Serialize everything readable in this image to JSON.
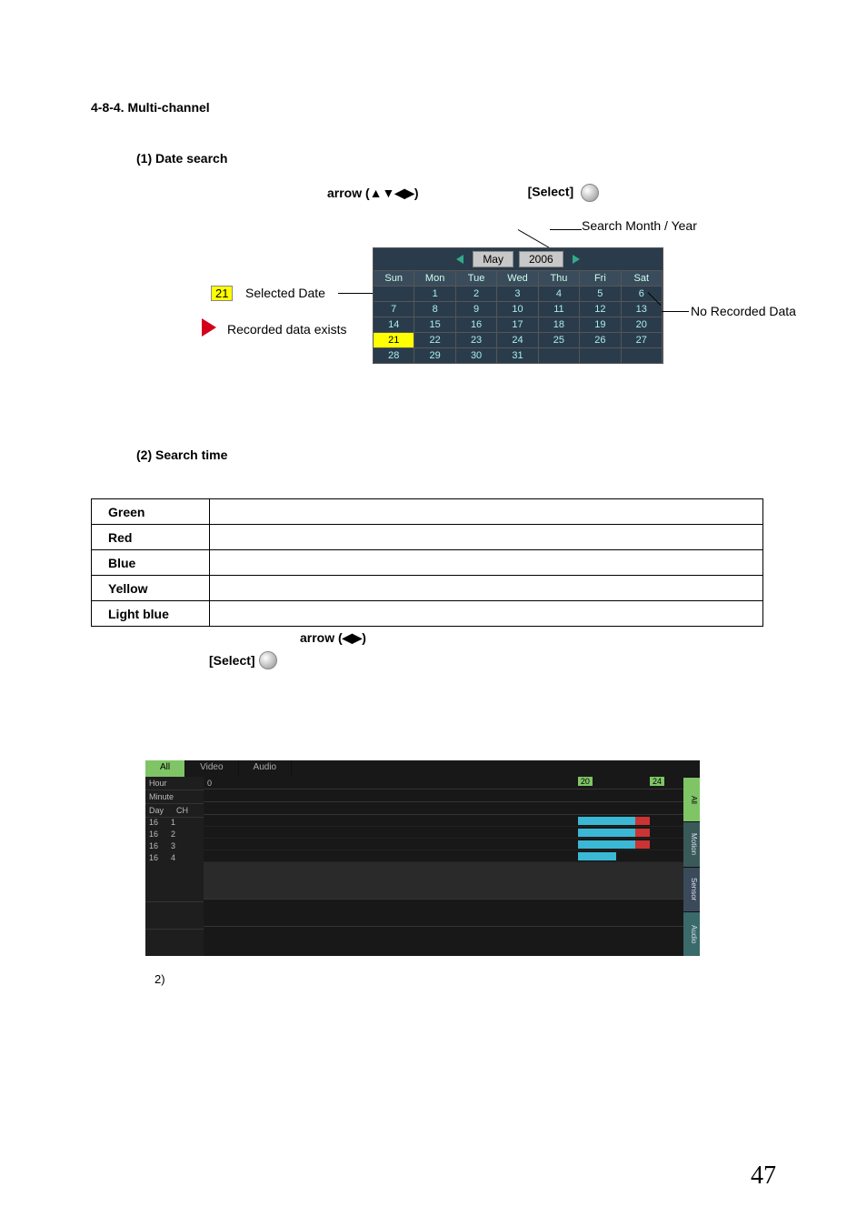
{
  "section_number": "4-8-4. Multi-channel",
  "sub1_heading": "(1) Date search",
  "arrow_label1": "arrow (▲▼◀▶)",
  "select_label1": "[Select]",
  "annot_search_my": "Search Month / Year",
  "selected_badge": "21",
  "selected_date_label": "Selected Date",
  "recorded_exists_label": "Recorded data exists",
  "no_recorded_label": "No Recorded Data",
  "calendar": {
    "month": "May",
    "year": "2006",
    "dow": [
      "Sun",
      "Mon",
      "Tue",
      "Wed",
      "Thu",
      "Fri",
      "Sat"
    ],
    "rows": [
      [
        "",
        "1",
        "2",
        "3",
        "4",
        "5",
        "6"
      ],
      [
        "7",
        "8",
        "9",
        "10",
        "11",
        "12",
        "13"
      ],
      [
        "14",
        "15",
        "16",
        "17",
        "18",
        "19",
        "20"
      ],
      [
        "21",
        "22",
        "23",
        "24",
        "25",
        "26",
        "27"
      ],
      [
        "28",
        "29",
        "30",
        "31",
        "",
        "",
        ""
      ]
    ],
    "selected": "21",
    "recorded_cells": [
      "21"
    ]
  },
  "sub2_heading": "(2) Search time",
  "color_table": [
    "Green",
    "Red",
    "Blue",
    "Yellow",
    "Light blue"
  ],
  "arrow_label2": "arrow (◀▶)",
  "select_label2": "[Select]",
  "timeline": {
    "tabs": [
      "All",
      "Video",
      "Audio"
    ],
    "active_tab": "All",
    "left_labels": {
      "hour": "Hour",
      "minute": "Minute",
      "day": "Day",
      "ch": "CH"
    },
    "rows": [
      {
        "day": "16",
        "ch": "1"
      },
      {
        "day": "16",
        "ch": "2"
      },
      {
        "day": "16",
        "ch": "3"
      },
      {
        "day": "16",
        "ch": "4"
      }
    ],
    "hour_start": "0",
    "badge_20": "20",
    "badge_24": "24",
    "right_tabs": [
      "All",
      "Motion",
      "Sensor",
      "Audio"
    ]
  },
  "footnote": "2)",
  "page_number": "47",
  "chart_data": {
    "type": "table",
    "title": "Search time color legend",
    "categories": [
      "Green",
      "Red",
      "Blue",
      "Yellow",
      "Light blue"
    ],
    "values": [
      "",
      "",
      "",
      "",
      ""
    ]
  }
}
